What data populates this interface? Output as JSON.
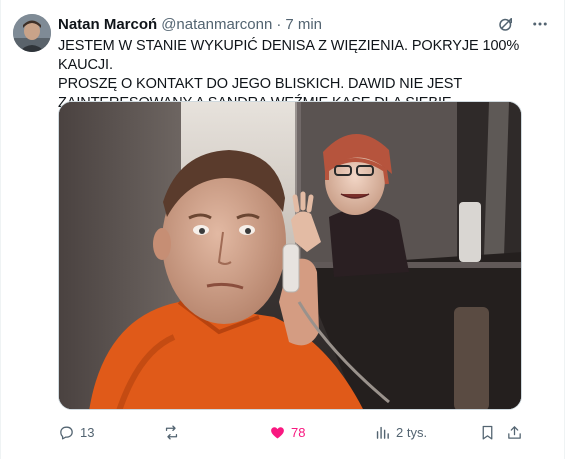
{
  "tweet": {
    "author": {
      "name": "Natan Marcoń",
      "handle": "@natanmarconn"
    },
    "separator": "·",
    "time": "7 min",
    "text": "JESTEM W STANIE WYKUPIĆ DENISA Z WIĘZIENIA. POKRYJE 100% KAUCJI.\nPROSZĘ O KONTAKT DO JEGO BLISKICH. DAWID NIE JEST\nZAINTERESOWANY A SANDRA WEŹMIE KASĘ DLA SIEBIE.",
    "stats": {
      "replies": "13",
      "reposts": "",
      "likes": "78",
      "views": "2 tys."
    }
  },
  "icons": {
    "grok": "grok-icon",
    "more": "more-dots-icon",
    "reply": "speech-bubble-icon",
    "repost": "repost-arrows-icon",
    "like": "heart-icon",
    "views": "bar-chart-icon",
    "bookmark": "bookmark-icon",
    "share": "share-upload-icon"
  },
  "colors": {
    "text": "#0f1419",
    "secondary": "#536471",
    "like": "#f91880",
    "border": "#cfd9de"
  }
}
